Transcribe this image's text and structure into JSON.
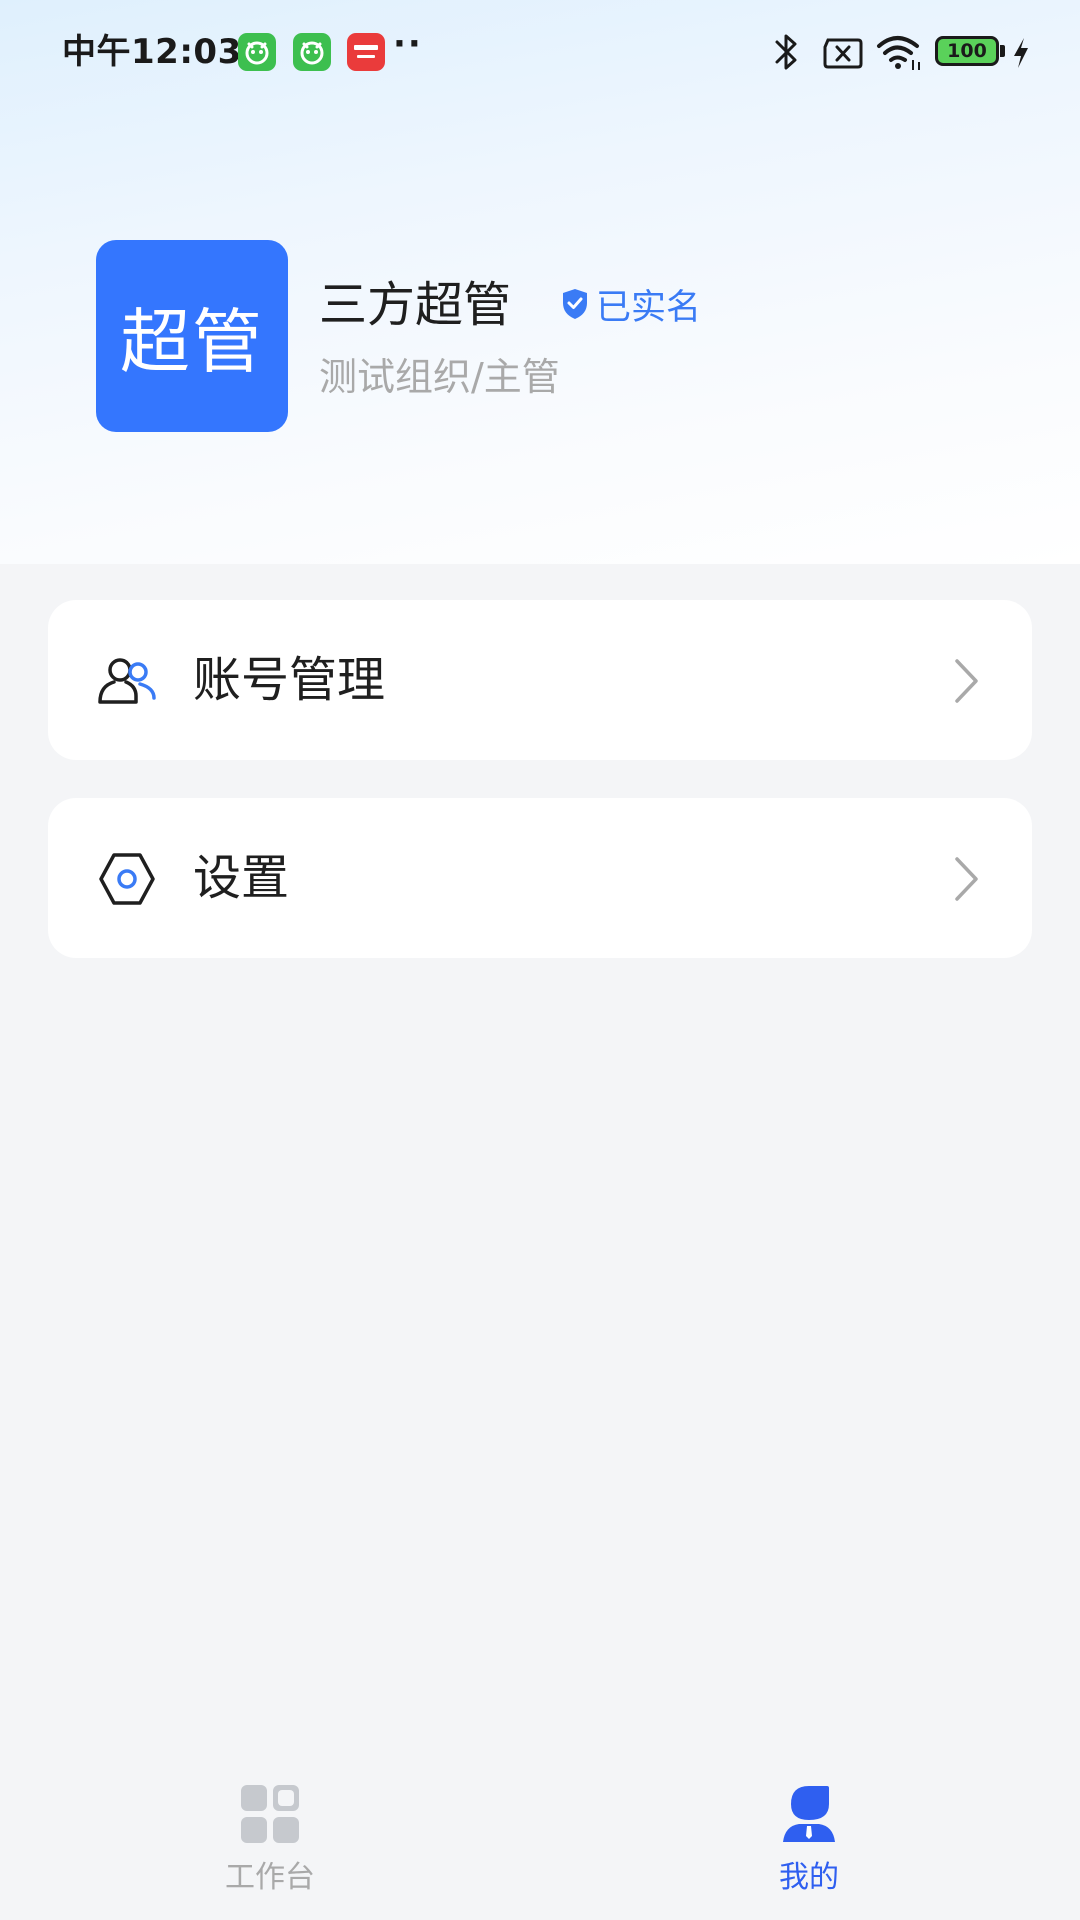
{
  "status_bar": {
    "time": "中午12:03",
    "battery": "100"
  },
  "profile": {
    "avatar_text": "超管",
    "name": "三方超管",
    "verified_label": "已实名",
    "org": "测试组织/主管"
  },
  "menu": {
    "items": [
      {
        "label": "账号管理",
        "icon": "account-group-icon"
      },
      {
        "label": "设置",
        "icon": "settings-hexagon-icon"
      }
    ]
  },
  "bottom_nav": {
    "items": [
      {
        "label": "工作台",
        "icon": "workbench-grid-icon",
        "active": false
      },
      {
        "label": "我的",
        "icon": "profile-person-icon",
        "active": true
      }
    ]
  },
  "colors": {
    "accent": "#3476fe",
    "verified": "#3a7bf5",
    "nav_active": "#2f5ff0",
    "nav_inactive": "#a9a9a9",
    "notif_green": "#3dbf4f",
    "notif_red": "#ea3b3b"
  }
}
